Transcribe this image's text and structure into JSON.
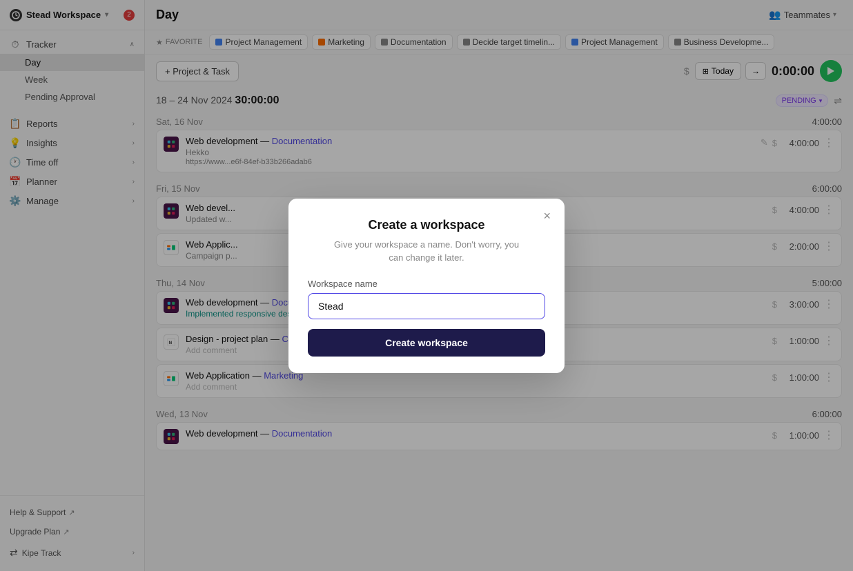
{
  "sidebar": {
    "workspace_name": "Stead Workspace",
    "notification_count": "2",
    "tracker_label": "Tracker",
    "nav_items": [
      {
        "id": "day",
        "label": "Day",
        "active": true
      },
      {
        "id": "week",
        "label": "Week",
        "active": false
      },
      {
        "id": "pending",
        "label": "Pending Approval",
        "active": false
      }
    ],
    "sections": [
      {
        "id": "reports",
        "label": "Reports",
        "icon": "📋"
      },
      {
        "id": "insights",
        "label": "Insights",
        "icon": "💡"
      },
      {
        "id": "timeoff",
        "label": "Time off",
        "icon": "🕐"
      },
      {
        "id": "planner",
        "label": "Planner",
        "icon": "📅"
      },
      {
        "id": "manage",
        "label": "Manage",
        "icon": "⚙️"
      }
    ],
    "bottom": {
      "help": "Help & Support",
      "upgrade": "Upgrade Plan",
      "workspace_switcher": "Kipe Track"
    }
  },
  "header": {
    "title": "Day",
    "teammates_label": "Teammates"
  },
  "favorites": {
    "label": "FAVORITE",
    "items": [
      {
        "id": "pm1",
        "label": "Project Management",
        "color": "#4285f4"
      },
      {
        "id": "mkt",
        "label": "Marketing",
        "color": "#ff6d00"
      },
      {
        "id": "doc",
        "label": "Documentation",
        "color": "#888"
      },
      {
        "id": "target",
        "label": "Decide target timelin...",
        "color": "#888"
      },
      {
        "id": "pm2",
        "label": "Project Management",
        "color": "#4285f4"
      },
      {
        "id": "bizdev",
        "label": "Business Developme...",
        "color": "#888"
      }
    ]
  },
  "toolbar": {
    "add_label": "+ Project & Task",
    "today_label": "Today",
    "timer": "0:00:00"
  },
  "week_summary": {
    "range": "18 – 24 Nov 2024",
    "total": "30:00:00",
    "status": "PENDING"
  },
  "days": [
    {
      "label": "Sat, 16 Nov",
      "total": "4:00:00",
      "entries": [
        {
          "app": "Slack",
          "app_type": "slack",
          "title": "Web development",
          "title_link_label": "Documentation",
          "comment": "Hekko",
          "link": "https://www...e6f-84ef-b33b266adab6",
          "dollar": true,
          "time": "4:00:00"
        }
      ]
    },
    {
      "label": "Fri, 15 Nov",
      "total": "6:00:00",
      "entries": [
        {
          "app": "Slack",
          "app_type": "slack",
          "title": "Web devel...",
          "title_link_label": "",
          "comment": "Updated w...",
          "link": "",
          "dollar": true,
          "time": "4:00:00"
        },
        {
          "app": "Airtable",
          "app_type": "airtable",
          "title": "Web Applic...",
          "title_link_label": "",
          "comment": "Campaign p...",
          "link": "",
          "dollar": true,
          "time": "2:00:00"
        }
      ]
    },
    {
      "label": "Thu, 14 Nov",
      "total": "5:00:00",
      "entries": [
        {
          "app": "Slack",
          "app_type": "slack",
          "title": "Web development",
          "title_link_label": "Documentation",
          "comment": "Implemented responsive design for mobile devices",
          "link": "",
          "dollar": true,
          "time": "3:00:00",
          "comment_color": "teal"
        },
        {
          "app": "Notion",
          "app_type": "notion",
          "title": "Design - project plan",
          "title_link_label": "Competitor analysis and exploration",
          "comment": "Add comment",
          "link": "",
          "dollar": true,
          "time": "1:00:00",
          "comment_placeholder": true
        },
        {
          "app": "Airtable",
          "app_type": "airtable",
          "title": "Web Application",
          "title_link_label": "Marketing",
          "comment": "Add comment",
          "link": "",
          "dollar": true,
          "time": "1:00:00",
          "comment_placeholder": true
        }
      ]
    },
    {
      "label": "Wed, 13 Nov",
      "total": "6:00:00",
      "entries": [
        {
          "app": "Slack",
          "app_type": "slack",
          "title": "Web development",
          "title_link_label": "Documentation",
          "comment": "",
          "link": "",
          "dollar": true,
          "time": "1:00:00"
        }
      ]
    }
  ],
  "modal": {
    "title": "Create a workspace",
    "subtitle": "Give your workspace a name. Don't worry, you\ncan change it later.",
    "label": "Workspace name",
    "input_value": "Stead",
    "submit_label": "Create workspace",
    "close_label": "×"
  }
}
